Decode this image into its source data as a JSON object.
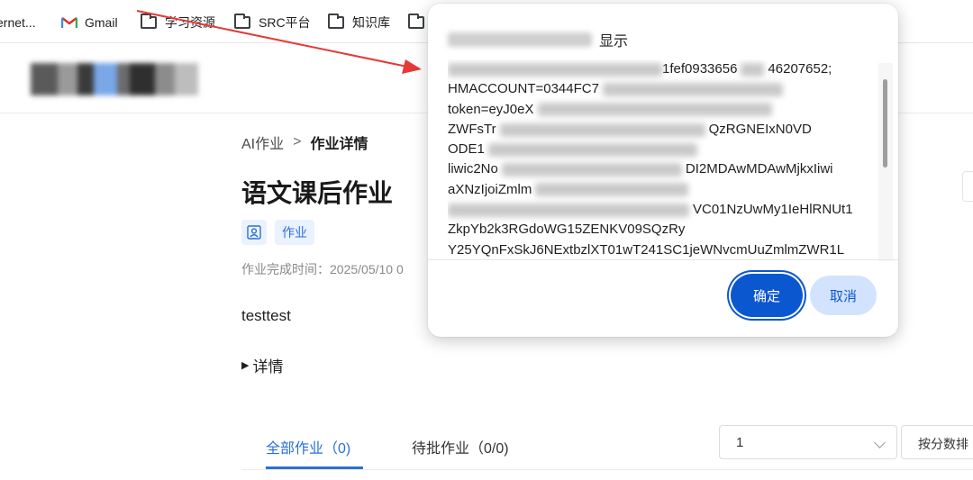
{
  "bookmarks": [
    {
      "label": "ernet...",
      "icon": "folder-icon"
    },
    {
      "label": "Gmail",
      "icon": "gmail-icon"
    },
    {
      "label": "学习资源",
      "icon": "folder-icon"
    },
    {
      "label": "SRC平台",
      "icon": "folder-icon"
    },
    {
      "label": "知识库",
      "icon": "folder-icon"
    }
  ],
  "breadcrumb": {
    "parent": "AI作业",
    "separator": ">",
    "current": "作业详情"
  },
  "page": {
    "title": "语文课后作业",
    "tag": "作业",
    "completion_label": "作业完成时间：2025/05/10 0",
    "description": "testtest",
    "details_label": "详情"
  },
  "tabs": [
    {
      "label": "全部作业（0)",
      "active": true
    },
    {
      "label": "待批作业（0/0)",
      "active": false
    }
  ],
  "filters": {
    "select_value": "1",
    "sort_label": "按分数排"
  },
  "dialog": {
    "title_suffix": "显示",
    "lines": [
      {
        "text": "1fef0933656",
        "tail": "46207652;"
      },
      {
        "text": "HMACCOUNT=0344FC7"
      },
      {
        "text": "token=eyJ0eX"
      },
      {
        "text": "ZWFsTr",
        "tail": "QzRGNEIxN0VD"
      },
      {
        "text": "ODE1"
      },
      {
        "text": "liwic2No",
        "tail": "DI2MDAwMDAwMjkxIiwi"
      },
      {
        "text": "aXNzIjoiZmlm"
      },
      {
        "text": "",
        "tail": "VC01NzUwMy1IeHlRNUt1"
      },
      {
        "text": "ZkpYb2k3RGdoWG15ZENKV09SQzRy"
      },
      {
        "text": "Y25YQnFxSkJ6NExtbzlXT01wT241SC1jeWNvcmUuZmlmZWR1L"
      }
    ],
    "ok_label": "确定",
    "cancel_label": "取消"
  },
  "colors": {
    "accent": "#2b6fd6",
    "dialog_primary": "#0b57d0",
    "dialog_secondary": "#d3e3fd",
    "annotation": "#e53935"
  }
}
